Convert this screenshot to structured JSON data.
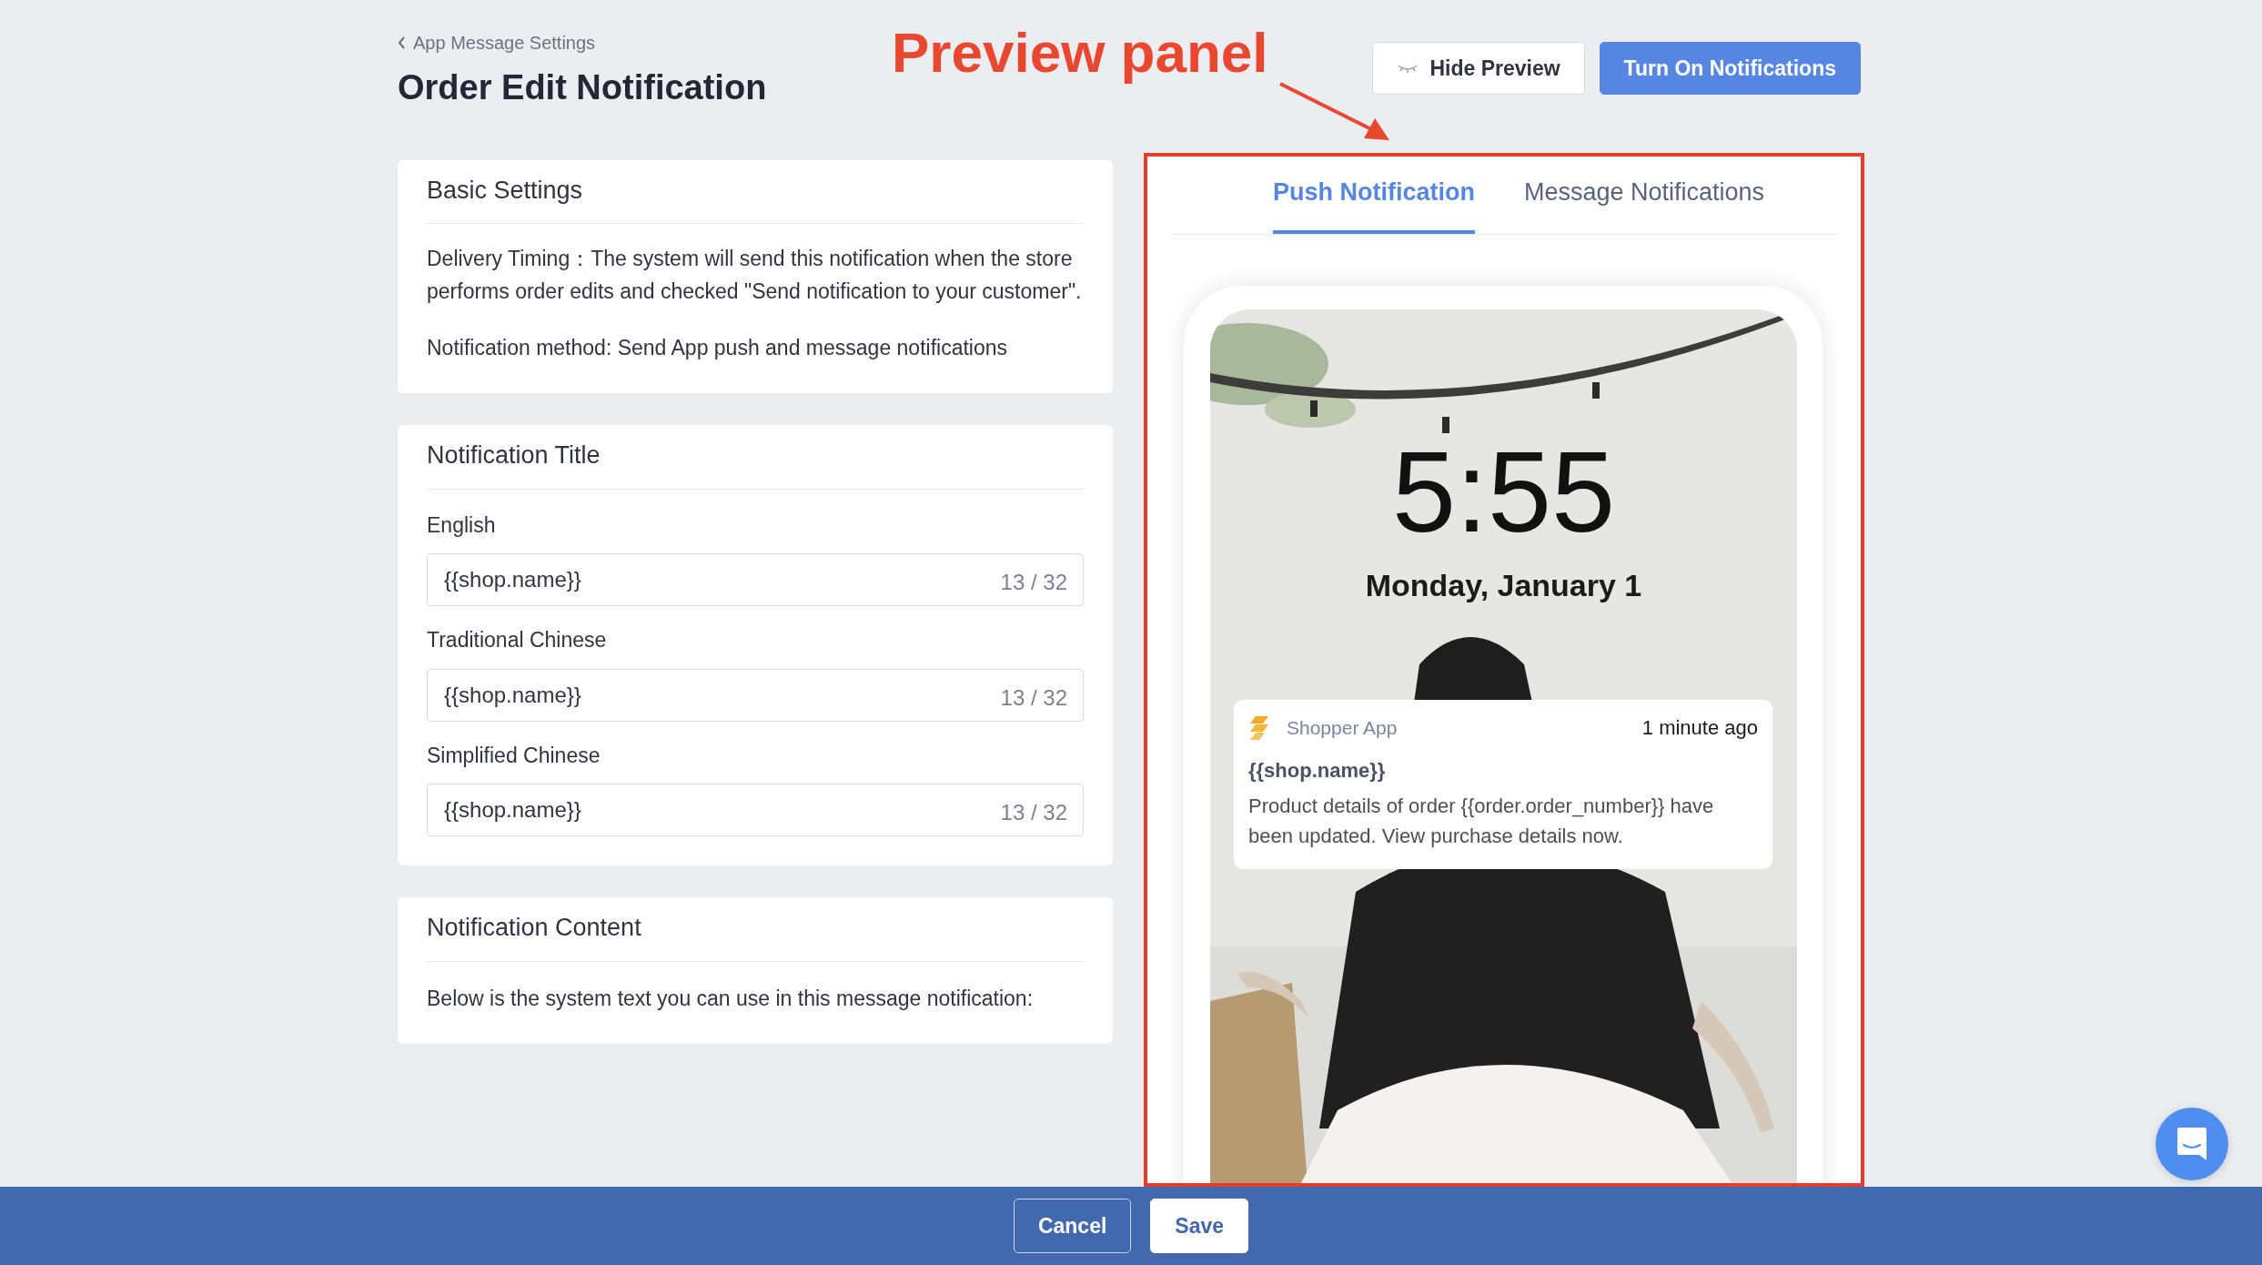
{
  "breadcrumb": {
    "label": "App Message Settings"
  },
  "page_title": "Order Edit Notification",
  "annotation": {
    "label": "Preview panel"
  },
  "header_buttons": [
    {
      "label": "Hide Preview",
      "kind": "secondary"
    },
    {
      "label": "Turn On Notifications",
      "kind": "primary"
    }
  ],
  "basic_settings": {
    "title": "Basic Settings",
    "paragraphs": [
      "Delivery Timing：The system will send this notification when the store performs order edits and checked \"Send notification to your customer\".",
      "Notification method: Send App push and message notifications"
    ]
  },
  "notification_title": {
    "title": "Notification Title",
    "fields": [
      {
        "label": "English",
        "value": "{{shop.name}}",
        "count": "13 / 32"
      },
      {
        "label": "Traditional Chinese",
        "value": "{{shop.name}}",
        "count": "13 / 32"
      },
      {
        "label": "Simplified Chinese",
        "value": "{{shop.name}}",
        "count": "13 / 32"
      }
    ]
  },
  "notification_content": {
    "title": "Notification Content",
    "text": "Below is the system text you can use in this message notification:"
  },
  "preview": {
    "tabs": [
      {
        "label": "Push Notification",
        "selected": true
      },
      {
        "label": "Message Notifications",
        "selected": false
      }
    ],
    "lock_screen": {
      "time": "5:55",
      "date": "Monday, January 1"
    },
    "notification": {
      "app": "Shopper App",
      "time": "1 minute ago",
      "title": "{{shop.name}}",
      "body": "Product details of order {{order.order_number}} have been updated. View purchase details now."
    }
  },
  "footer_buttons": [
    {
      "label": "Cancel",
      "kind": "outline"
    },
    {
      "label": "Save",
      "kind": "primary"
    }
  ]
}
